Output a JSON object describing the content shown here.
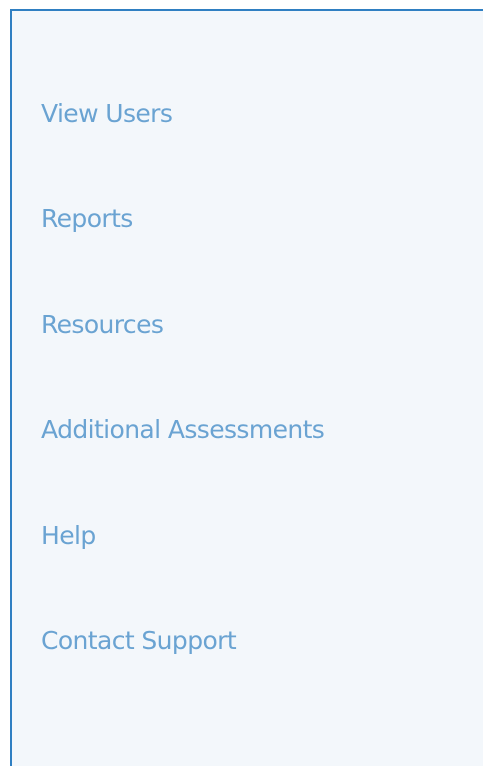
{
  "sidebar": {
    "items": [
      {
        "label": "View Users"
      },
      {
        "label": "Reports"
      },
      {
        "label": "Resources"
      },
      {
        "label": "Additional Assessments"
      },
      {
        "label": "Help"
      },
      {
        "label": "Contact Support"
      }
    ]
  },
  "colors": {
    "panel_background": "#f3f7fb",
    "panel_border": "#2f7fc2",
    "link_text": "#6aa3d2"
  }
}
